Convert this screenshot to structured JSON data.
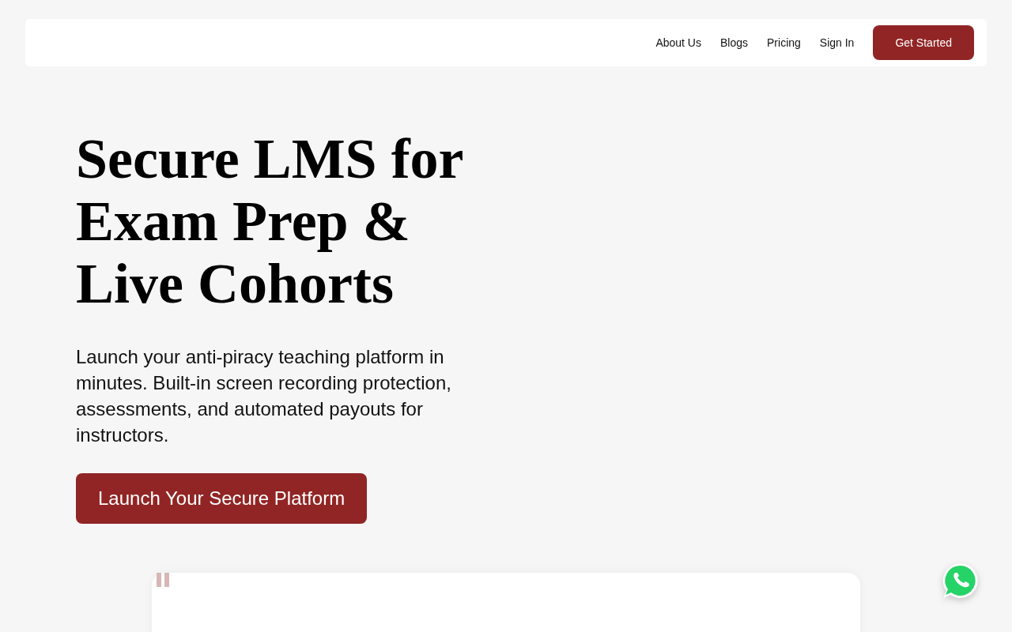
{
  "nav": {
    "links": [
      {
        "label": "About Us"
      },
      {
        "label": "Blogs"
      },
      {
        "label": "Pricing"
      },
      {
        "label": "Sign In"
      }
    ],
    "cta": "Get Started"
  },
  "hero": {
    "title": "Secure LMS for Exam Prep & Live Cohorts",
    "subtitle": "Launch your anti-piracy teaching platform in minutes. Built-in screen recording protection, assessments, and automated payouts for instructors.",
    "button": "Launch Your Secure Platform"
  }
}
